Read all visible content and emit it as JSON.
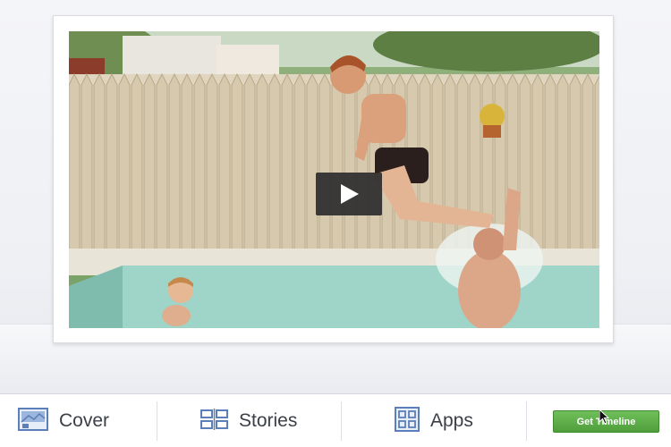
{
  "video": {
    "play_icon": "play-icon"
  },
  "tabs": [
    {
      "label": "Cover",
      "icon": "cover-photo-icon"
    },
    {
      "label": "Stories",
      "icon": "stories-icon"
    },
    {
      "label": "Apps",
      "icon": "apps-grid-icon"
    }
  ],
  "cta": {
    "label": "Get Timeline"
  },
  "colors": {
    "accent_green": "#5aad45",
    "icon_blue": "#5b7fb8",
    "tab_text": "#3b3f47"
  }
}
